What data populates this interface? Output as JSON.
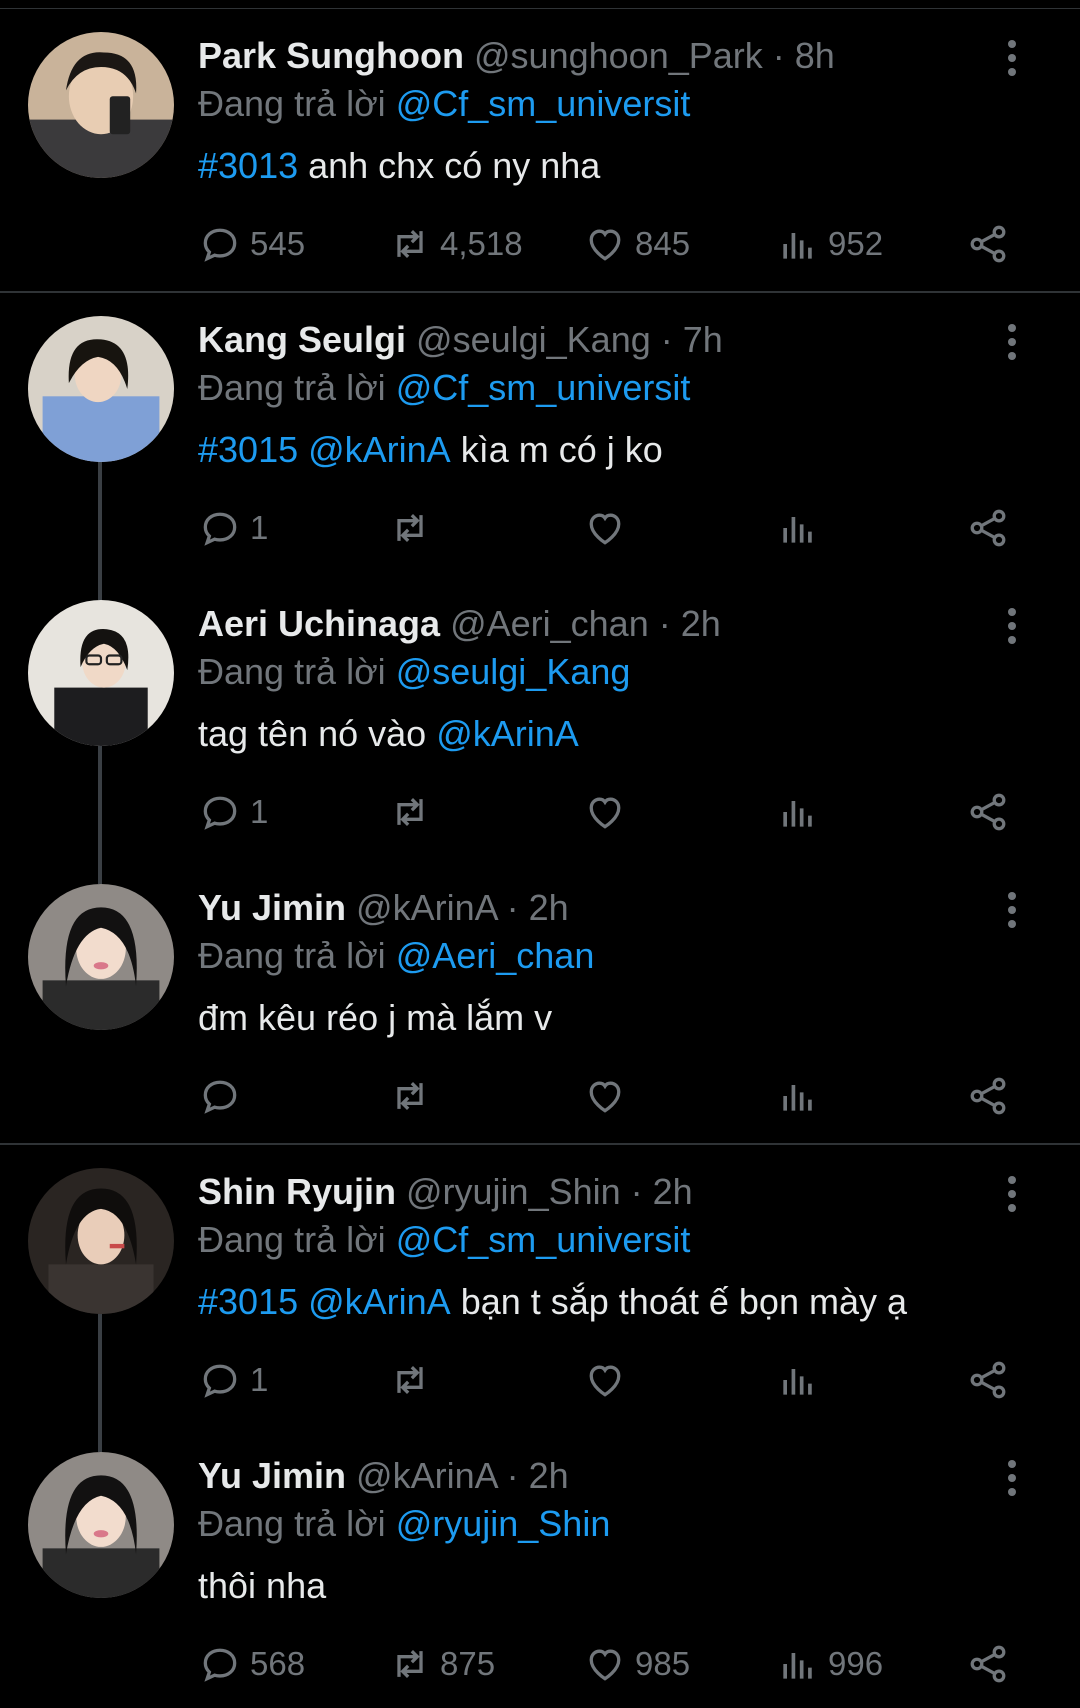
{
  "tweets": [
    {
      "name": "Park Sunghoon",
      "handle": "@sunghoon_Park",
      "time": "8h",
      "reply_label": "Đang trả lời",
      "reply_to": "@Cf_sm_universit",
      "tags": [
        "#3013"
      ],
      "text": "anh chx có ny nha",
      "counts": {
        "reply": "545",
        "retweet": "4,518",
        "like": "845",
        "views": "952"
      }
    },
    {
      "name": "Kang Seulgi",
      "handle": "@seulgi_Kang",
      "time": "7h",
      "reply_label": "Đang trả lời",
      "reply_to": "@Cf_sm_universit",
      "tags": [
        "#3015",
        "@kArinA"
      ],
      "text": "kìa m có j ko",
      "counts": {
        "reply": "1",
        "retweet": "",
        "like": "",
        "views": ""
      }
    },
    {
      "name": "Aeri Uchinaga",
      "handle": "@Aeri_chan",
      "time": "2h",
      "reply_label": "Đang trả lời",
      "reply_to": "@seulgi_Kang",
      "text": "tag tên nó vào",
      "trailing_tag": "@kArinA",
      "counts": {
        "reply": "1",
        "retweet": "",
        "like": "",
        "views": ""
      }
    },
    {
      "name": "Yu Jimin",
      "handle": "@kArinA",
      "time": "2h",
      "reply_label": "Đang trả lời",
      "reply_to": "@Aeri_chan",
      "text": "đm kêu réo j mà lắm v",
      "counts": {
        "reply": "",
        "retweet": "",
        "like": "",
        "views": ""
      }
    },
    {
      "name": "Shin Ryujin",
      "handle": "@ryujin_Shin",
      "time": "2h",
      "reply_label": "Đang trả lời",
      "reply_to": "@Cf_sm_universit",
      "tags": [
        "#3015",
        "@kArinA"
      ],
      "text": "bạn t sắp thoát ế bọn mày ạ",
      "counts": {
        "reply": "1",
        "retweet": "",
        "like": "",
        "views": ""
      }
    },
    {
      "name": "Yu Jimin",
      "handle": "@kArinA",
      "time": "2h",
      "reply_label": "Đang trả lời",
      "reply_to": "@ryujin_Shin",
      "text": "thôi nha",
      "counts": {
        "reply": "568",
        "retweet": "875",
        "like": "985",
        "views": "996"
      }
    }
  ],
  "colors": {
    "background": "#000000",
    "text": "#e7e9ea",
    "muted": "#71767b",
    "link": "#1d9bf0",
    "divider": "#2f3336"
  },
  "icons": [
    "reply-icon",
    "retweet-icon",
    "like-icon",
    "views-icon",
    "share-icon",
    "more-icon"
  ]
}
